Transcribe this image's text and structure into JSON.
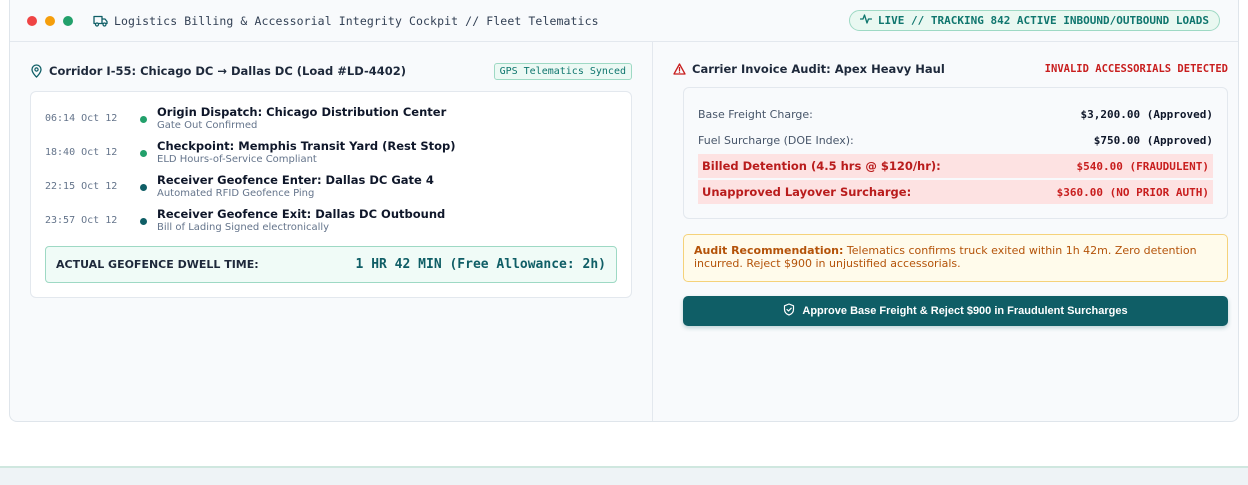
{
  "window": {
    "title": "Logistics Billing & Accessorial Integrity Cockpit // Fleet Telematics",
    "live_status": "LIVE // TRACKING 842 ACTIVE INBOUND/OUTBOUND LOADS",
    "traffic_lights": [
      "#ef4444",
      "#f59e0b",
      "#22a06b"
    ]
  },
  "corridor": {
    "title": "Corridor I-55: Chicago DC → Dallas DC (Load #LD-4402)",
    "sync_badge": "GPS Telematics Synced",
    "events": [
      {
        "time": "06:14 Oct 12",
        "title": "Origin Dispatch: Chicago Distribution Center",
        "subtitle": "Gate Out Confirmed",
        "dot_color": "#22a06b"
      },
      {
        "time": "18:40 Oct 12",
        "title": "Checkpoint: Memphis Transit Yard (Rest Stop)",
        "subtitle": "ELD Hours-of-Service Compliant",
        "dot_color": "#22a06b"
      },
      {
        "time": "22:15 Oct 12",
        "title": "Receiver Geofence Enter: Dallas DC Gate 4",
        "subtitle": "Automated RFID Geofence Ping",
        "dot_color": "#0f5e66"
      },
      {
        "time": "23:57 Oct 12",
        "title": "Receiver Geofence Exit: Dallas DC Outbound",
        "subtitle": "Bill of Lading Signed electronically",
        "dot_color": "#0f5e66"
      }
    ],
    "dwell_label": "ACTUAL GEOFENCE DWELL TIME:",
    "dwell_value": "1 HR 42 MIN (Free Allowance: 2h)"
  },
  "audit": {
    "title": "Carrier Invoice Audit: Apex Heavy Haul",
    "status": "INVALID ACCESSORIALS DETECTED",
    "lines": [
      {
        "label": "Base Freight Charge:",
        "value": "$3,200.00 (Approved)"
      },
      {
        "label": "Fuel Surcharge (DOE Index):",
        "value": "$750.00 (Approved)"
      },
      {
        "label": "Billed Detention (4.5 hrs @ $120/hr):",
        "value": "$540.00 (FRAUDULENT)"
      },
      {
        "label": "Unapproved Layover Surcharge:",
        "value": "$360.00 (NO PRIOR AUTH)"
      }
    ],
    "recommendation_heading": "Audit Recommendation:",
    "recommendation_text": "Telematics confirms truck exited within 1h 42m. Zero detention incurred. Reject $900 in unjustified accessorials.",
    "action_label": "Approve Base Freight & Reject $900 in Fraudulent Surcharges"
  }
}
